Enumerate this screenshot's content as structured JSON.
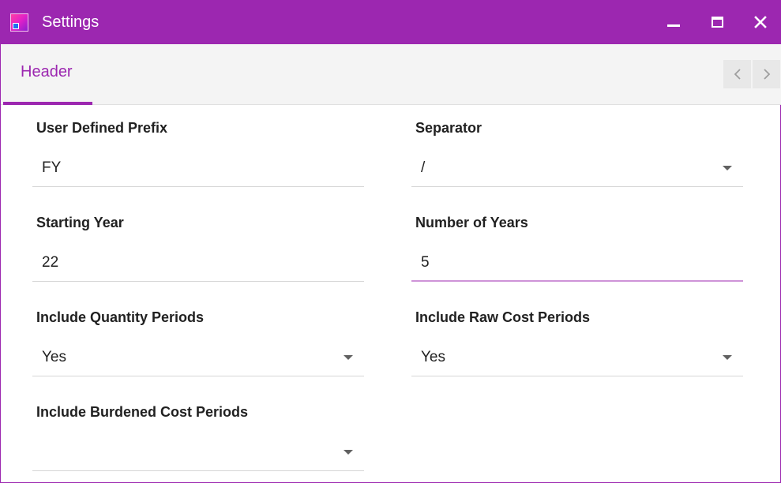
{
  "window": {
    "title": "Settings",
    "icons": {
      "app": "app-logo-icon",
      "minimize": "minimize-icon",
      "maximize": "maximize-icon",
      "close": "close-icon"
    }
  },
  "tabs": {
    "items": [
      {
        "label": "Header",
        "active": true
      }
    ],
    "scroll_icons": {
      "prev": "chevron-left-icon",
      "next": "chevron-right-icon"
    }
  },
  "form": {
    "user_defined_prefix": {
      "label": "User Defined Prefix",
      "value": "FY"
    },
    "separator": {
      "label": "Separator",
      "value": "/"
    },
    "starting_year": {
      "label": "Starting Year",
      "value": "22"
    },
    "number_of_years": {
      "label": "Number of Years",
      "value": "5"
    },
    "include_quantity_periods": {
      "label": "Include Quantity Periods",
      "value": "Yes"
    },
    "include_raw_cost_periods": {
      "label": "Include Raw Cost Periods",
      "value": "Yes"
    },
    "include_burdened_cost_periods": {
      "label": "Include Burdened Cost Periods",
      "value": ""
    }
  },
  "colors": {
    "accent": "#9c27b0",
    "focus_underline": "#ce93d8",
    "tab_bar_bg": "#f4f4f4"
  }
}
